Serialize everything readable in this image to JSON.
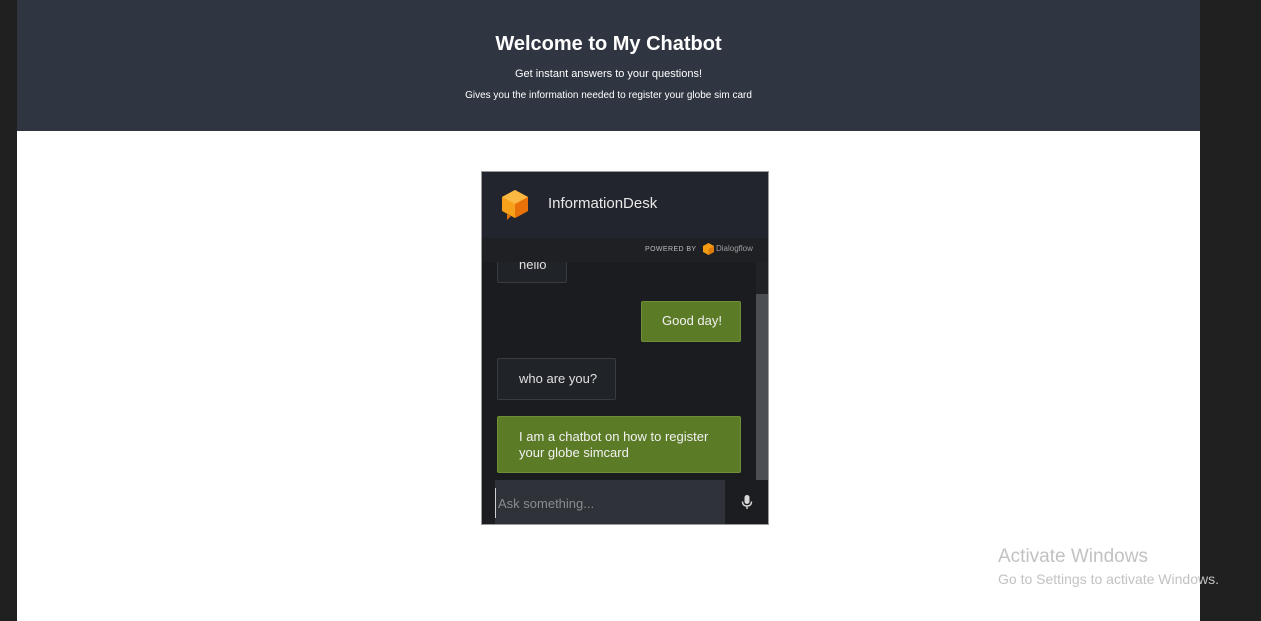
{
  "header": {
    "title": "Welcome to My Chatbot",
    "subtitle": "Get instant answers to your questions!",
    "description": "Gives you the information needed to register your globe sim card"
  },
  "chat_widget": {
    "agent_name": "InformationDesk",
    "powered_by": "POWERED BY",
    "powered_brand": "Dialogflow",
    "messages": [
      {
        "from": "bot",
        "text": "hello"
      },
      {
        "from": "user",
        "text": "Good day!"
      },
      {
        "from": "bot",
        "text": "who are you?"
      },
      {
        "from": "user",
        "text": "I am a chatbot on how to register your globe simcard"
      }
    ],
    "input_placeholder": "Ask something...",
    "mic_icon": "microphone-icon",
    "logo_icon": "dialogflow-cube-icon",
    "colors": {
      "user_bubble": "#5b7b26",
      "header_bg": "#2f3541",
      "widget_bg": "#1a1c1f",
      "logo": "#f39c12"
    }
  },
  "watermark": {
    "line1": "Activate Windows",
    "line2": "Go to Settings to activate Windows."
  }
}
